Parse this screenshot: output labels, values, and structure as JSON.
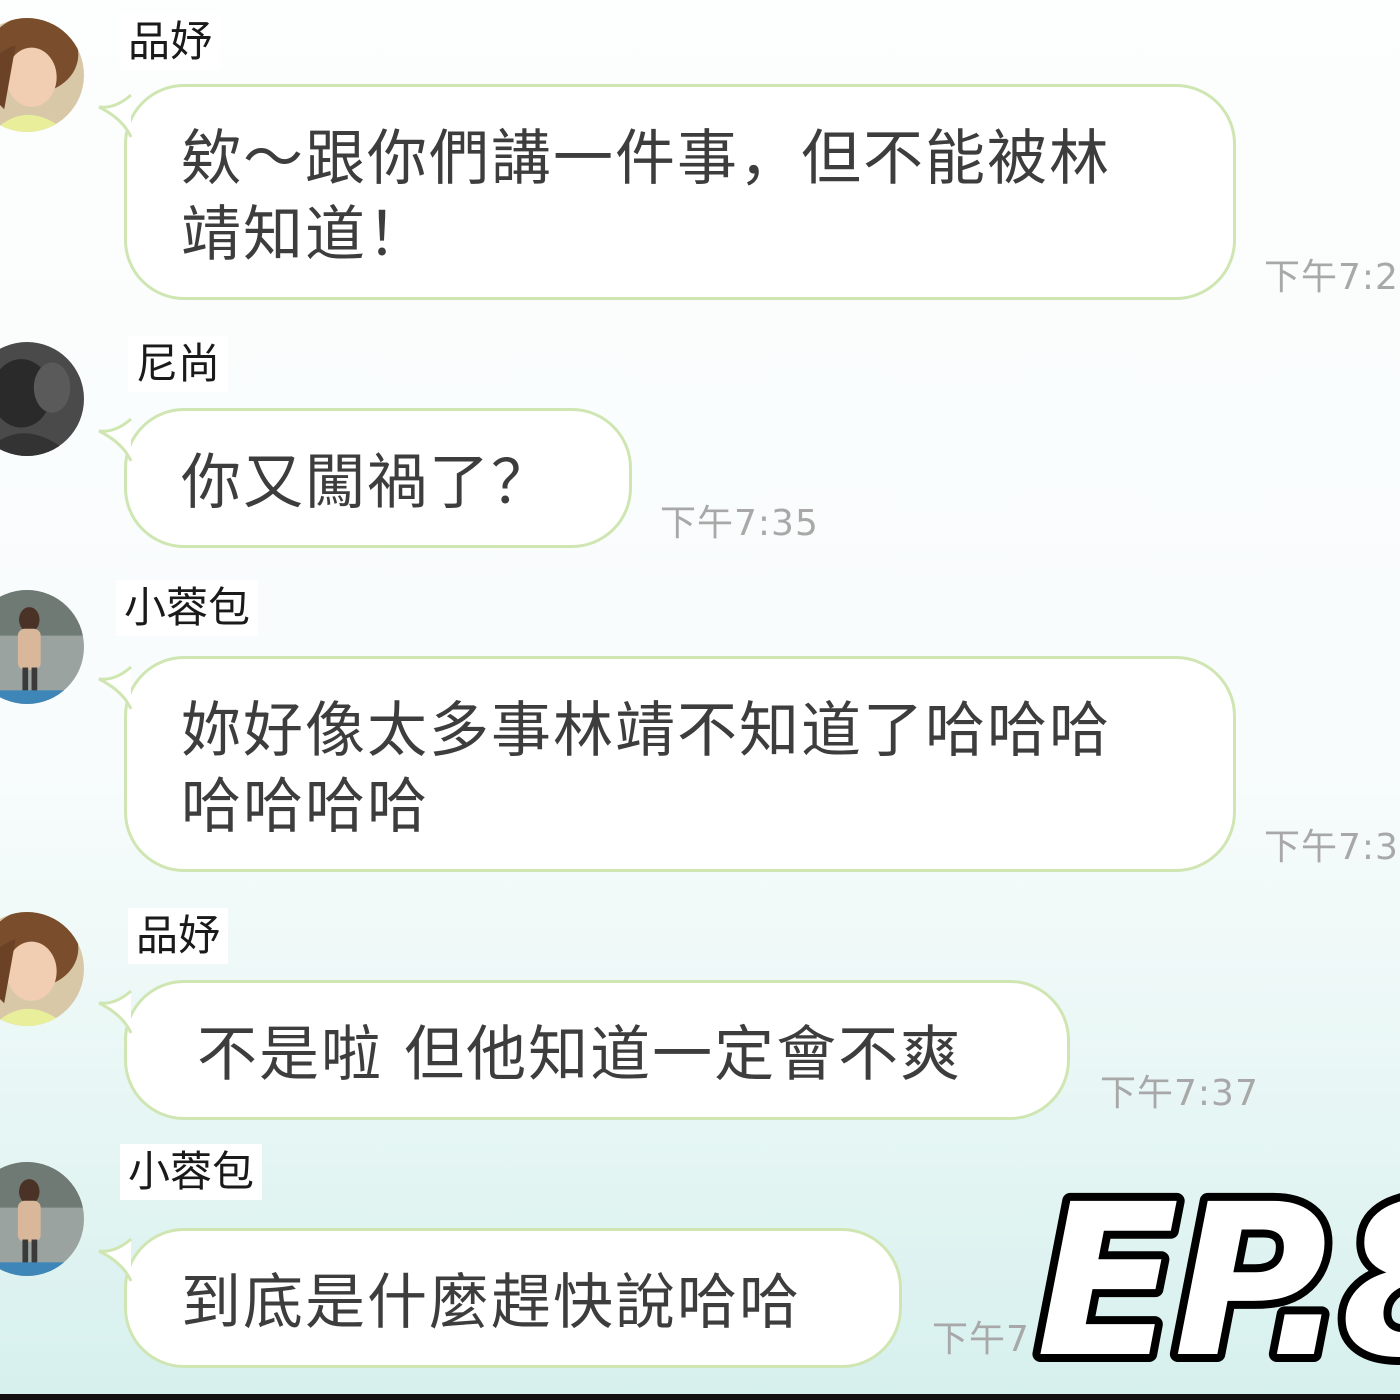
{
  "messages": [
    {
      "sender": "品妤",
      "avatar": "avatar-woman-smiling",
      "text": "欸～跟你們講一件事，但不能被林\n靖知道！",
      "time": "下午7:2"
    },
    {
      "sender": "尼尚",
      "avatar": "avatar-dark-photo",
      "text": "你又闖禍了？",
      "time": "下午7:35"
    },
    {
      "sender": "小蓉包",
      "avatar": "avatar-woman-standing",
      "text": "妳好像太多事林靖不知道了哈哈哈\n哈哈哈哈",
      "time": "下午7:3"
    },
    {
      "sender": "品妤",
      "avatar": "avatar-woman-smiling",
      "text": "不是啦 但他知道一定會不爽",
      "time": "下午7:37"
    },
    {
      "sender": "小蓉包",
      "avatar": "avatar-woman-standing",
      "text": "到底是什麼趕快說哈哈",
      "time": "下午7"
    }
  ],
  "episode_label": "EP.8",
  "colors": {
    "bubble_border": "#cfe6b2",
    "bubble_fill": "#ffffff",
    "message_text": "#3d3d3d",
    "timestamp": "#a8a8a8",
    "background_bottom": "#d6f0ee"
  }
}
